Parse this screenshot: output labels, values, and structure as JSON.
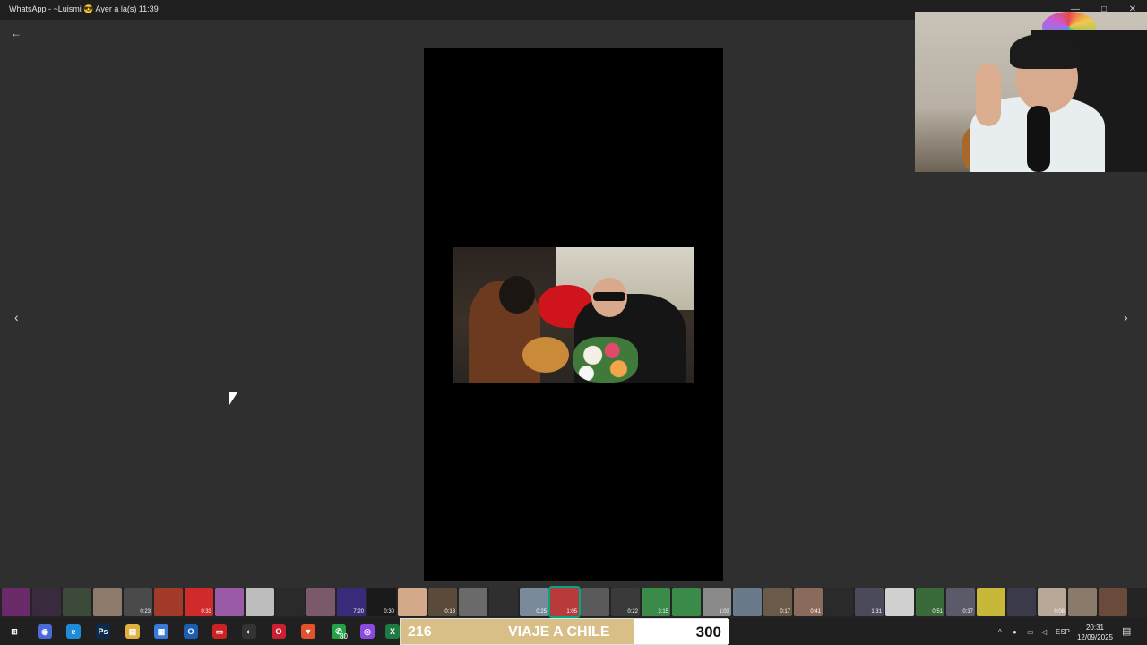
{
  "window": {
    "title": "WhatsApp - ~Luismi 😎 Ayer a la(s) 11:39",
    "controls": [
      "—",
      "□",
      "✕"
    ]
  },
  "viewer": {
    "back_icon": "←",
    "prev_icon": "‹",
    "next_icon": "›"
  },
  "thumbnails": [
    {
      "color": "#6a2a6a",
      "duration": ""
    },
    {
      "color": "#3a2a3e",
      "duration": ""
    },
    {
      "color": "#3c4a3a",
      "duration": ""
    },
    {
      "color": "#8d7a6a",
      "duration": ""
    },
    {
      "color": "#4a4a4a",
      "duration": "0:23"
    },
    {
      "color": "#a23a2a",
      "duration": ""
    },
    {
      "color": "#d02a2a",
      "duration": "0:33"
    },
    {
      "color": "#9a5aa8",
      "duration": ""
    },
    {
      "color": "#bdbdbd",
      "duration": ""
    },
    {
      "color": "#2a2a2a",
      "duration": ""
    },
    {
      "color": "#7a5a6a",
      "duration": ""
    },
    {
      "color": "#3a2a7a",
      "duration": "7:20"
    },
    {
      "color": "#1a1a1a",
      "duration": "0:30"
    },
    {
      "color": "#d3a98a",
      "duration": ""
    },
    {
      "color": "#5a4a3a",
      "duration": "0:18"
    },
    {
      "color": "#6a6a6a",
      "duration": ""
    },
    {
      "color": "#2f2f2f",
      "duration": ""
    },
    {
      "color": "#7a8a9a",
      "duration": "0:25"
    },
    {
      "color": "#b83a3a",
      "duration": "1:05",
      "active": true
    },
    {
      "color": "#5a5a5a",
      "duration": ""
    },
    {
      "color": "#3a3a3a",
      "duration": "0:22"
    },
    {
      "color": "#3a8a4a",
      "duration": "3:15"
    },
    {
      "color": "#3a8a4a",
      "duration": ""
    },
    {
      "color": "#8a8a8a",
      "duration": "1:03"
    },
    {
      "color": "#6a7a8a",
      "duration": ""
    },
    {
      "color": "#6a5a4a",
      "duration": "0:17"
    },
    {
      "color": "#8a6a5a",
      "duration": "0:41"
    },
    {
      "color": "#2a2a2a",
      "duration": ""
    },
    {
      "color": "#4a4a5a",
      "duration": "1:31"
    },
    {
      "color": "#d0d0d0",
      "duration": ""
    },
    {
      "color": "#3a6a3a",
      "duration": "0:51"
    },
    {
      "color": "#5a5a6a",
      "duration": "0:37"
    },
    {
      "color": "#c8b83a",
      "duration": ""
    },
    {
      "color": "#3a3a4a",
      "duration": ""
    },
    {
      "color": "#b8a898",
      "duration": "0:08"
    },
    {
      "color": "#8a7a6a",
      "duration": ""
    },
    {
      "color": "#6a4a3a",
      "duration": ""
    }
  ],
  "banner": {
    "left": "216",
    "middle": "VIAJE A CHILE",
    "right": "300"
  },
  "taskbar": {
    "whatsapp_badge": "80",
    "icons": [
      {
        "name": "windows-start-icon",
        "label": "⊞",
        "color": "#202020"
      },
      {
        "name": "copilot-icon",
        "label": "◉",
        "color": "#4a6ad8"
      },
      {
        "name": "edge-icon",
        "label": "e",
        "color": "#1f8ad8"
      },
      {
        "name": "photoshop-icon",
        "label": "Ps",
        "color": "#0c2b4a"
      },
      {
        "name": "file-explorer-icon",
        "label": "▤",
        "color": "#e0b040"
      },
      {
        "name": "microsoft-store-icon",
        "label": "▦",
        "color": "#3a7ad8"
      },
      {
        "name": "outlook-icon",
        "label": "O",
        "color": "#1a5fb4"
      },
      {
        "name": "app-icon",
        "label": "▭",
        "color": "#c22"
      },
      {
        "name": "obs-icon",
        "label": "◐",
        "color": "#333"
      },
      {
        "name": "opera-icon",
        "label": "O",
        "color": "#cc1f2f"
      },
      {
        "name": "brave-icon",
        "label": "▼",
        "color": "#e2532a"
      },
      {
        "name": "whatsapp-icon",
        "label": "✆",
        "color": "#25a244"
      },
      {
        "name": "messenger-icon",
        "label": "◎",
        "color": "#8a4ae0"
      },
      {
        "name": "excel-icon",
        "label": "X",
        "color": "#1d7a42"
      }
    ],
    "language": "ESP",
    "time": "20:31",
    "date": "12/09/2025"
  }
}
